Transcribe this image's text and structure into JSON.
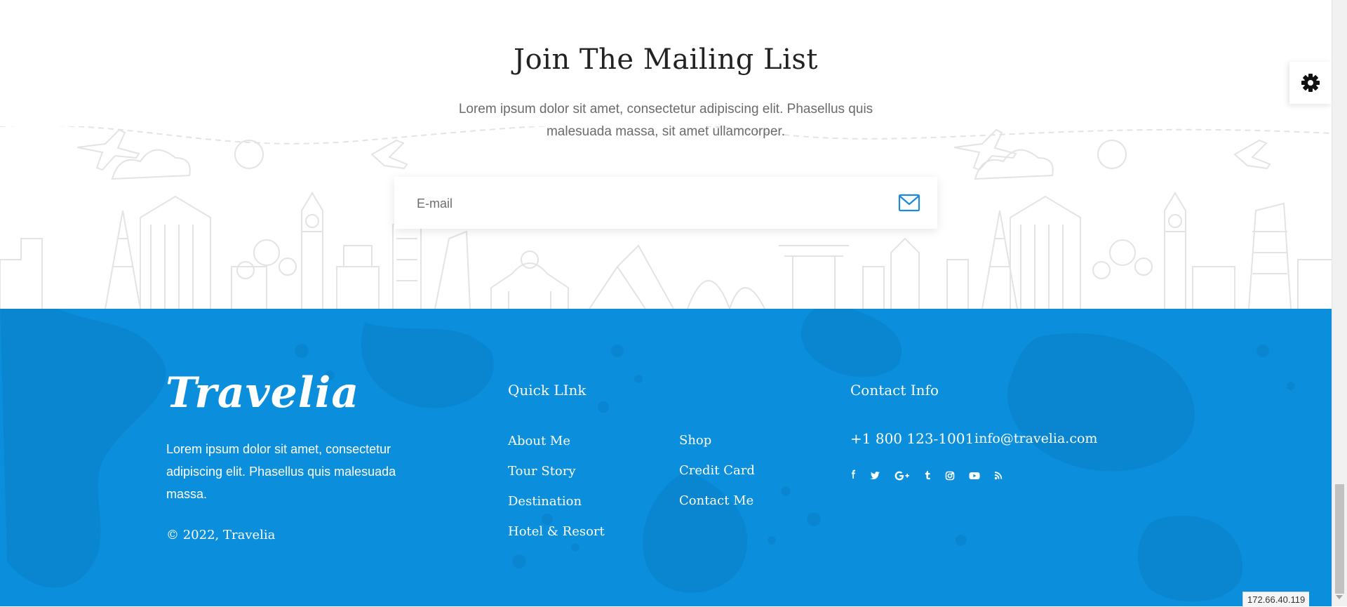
{
  "mailing": {
    "title": "Join The Mailing List",
    "description": "Lorem ipsum dolor sit amet, consectetur adipiscing elit. Phasellus quis malesuada massa, sit amet ullamcorper.",
    "email_placeholder": "E-mail",
    "send_icon": "envelope-icon"
  },
  "settings": {
    "icon": "gear-icon"
  },
  "footer": {
    "logo": "Travelia",
    "about": "Lorem ipsum dolor sit amet, consectetur adipiscing elit. Phasellus quis malesuada massa.",
    "copyright": "© 2022, Travelia",
    "quick_links": {
      "title": "Quick LInk",
      "column_a": [
        "About Me",
        "Tour Story",
        "Destination",
        "Hotel & Resort"
      ],
      "column_b": [
        "Shop",
        "Credit Card",
        "Contact Me"
      ]
    },
    "contact": {
      "title": "Contact Info",
      "phone": "+1 800 123-1001",
      "email": "info@travelia.com"
    },
    "social_icons": [
      "facebook-icon",
      "twitter-icon",
      "google-plus-icon",
      "tumblr-icon",
      "instagram-icon",
      "youtube-icon",
      "rss-icon"
    ]
  },
  "status": {
    "ip": "172.66.40.119"
  },
  "colors": {
    "accent": "#0b8fdc",
    "icon_blue": "#1a8ad8",
    "skyline": "#e3e3e3"
  }
}
